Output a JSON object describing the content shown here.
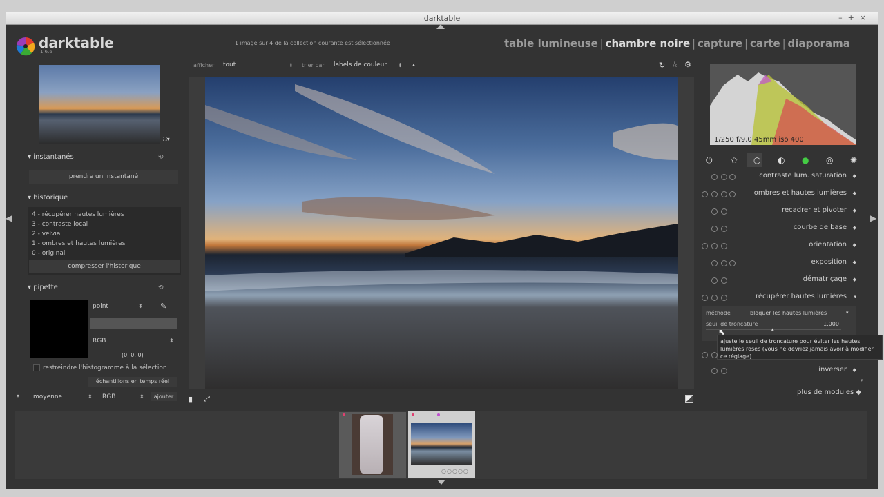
{
  "window": {
    "title": "darktable"
  },
  "app": {
    "name": "darktable",
    "version": "1.6.6"
  },
  "status": {
    "selection_text": "1 image sur 4 de la collection courante est sélectionnée"
  },
  "views": [
    {
      "label": "table lumineuse",
      "active": false
    },
    {
      "label": "chambre noire",
      "active": true
    },
    {
      "label": "capture",
      "active": false
    },
    {
      "label": "carte",
      "active": false
    },
    {
      "label": "diaporama",
      "active": false
    }
  ],
  "view_separator": "|",
  "filter": {
    "show_label": "afficher",
    "show_value": "tout",
    "sort_label": "trier par",
    "sort_value": "labels de couleur"
  },
  "snapshots": {
    "title": "instantanés",
    "button": "prendre un instantané"
  },
  "history": {
    "title": "historique",
    "items": [
      "4 - récupérer hautes lumières",
      "3 - contraste local",
      "2 - velvia",
      "1 - ombres et hautes lumières",
      "0 - original"
    ],
    "compress_button": "compresser l'historique"
  },
  "picker": {
    "title": "pipette",
    "mode": "point",
    "colorspace": "RGB",
    "values": "(0, 0, 0)",
    "restrict_label": "restreindre l'histogramme à la sélection",
    "live_button": "échantillons en temps réel",
    "bottom_mode": "moyenne",
    "bottom_space": "RGB",
    "add_button": "ajouter"
  },
  "histogram": {
    "exif": "1/250 f/9.0 45mm iso 400"
  },
  "modules": [
    {
      "label": "contraste lum. saturation"
    },
    {
      "label": "ombres et hautes lumières"
    },
    {
      "label": "recadrer et pivoter"
    },
    {
      "label": "courbe de base"
    },
    {
      "label": "orientation"
    },
    {
      "label": "exposition"
    },
    {
      "label": "dématriçage"
    },
    {
      "label": "récupérer hautes lumières"
    },
    {
      "label": "inverser"
    }
  ],
  "highlight_module": {
    "method_label": "méthode",
    "method_value": "bloquer les hautes lumières",
    "threshold_label": "seuil de troncature",
    "threshold_value": "1.000"
  },
  "tooltip": {
    "text": "ajuste le seuil de troncature pour éviter les hautes lumières roses (vous ne devriez jamais avoir à modifier ce réglage)"
  },
  "more_modules": "plus de modules",
  "colors": {
    "bg": "#333333",
    "panel": "#2a2a2a",
    "accent": "#dcdcdc"
  }
}
